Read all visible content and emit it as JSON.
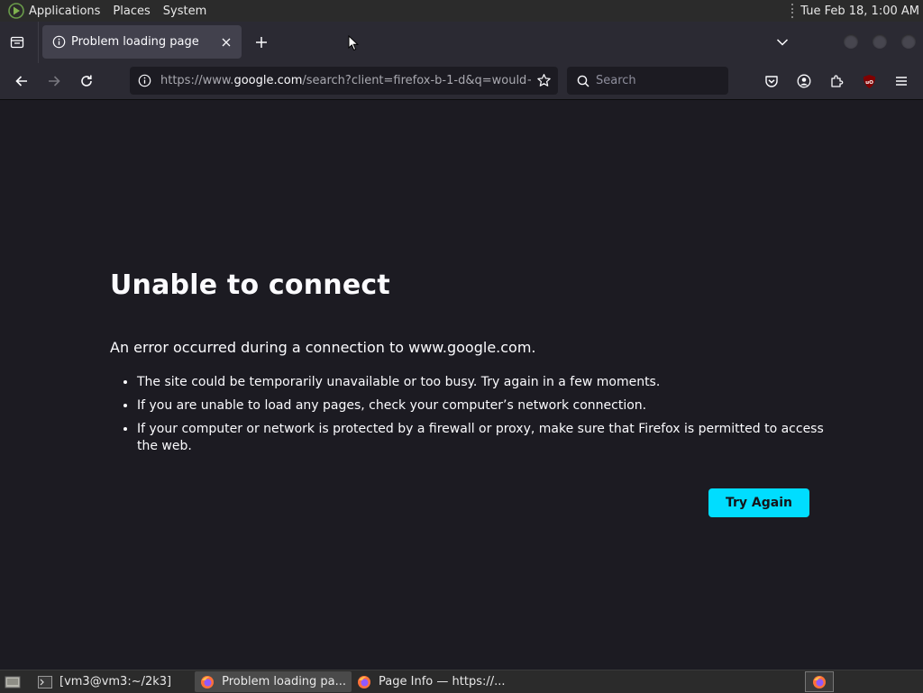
{
  "colors": {
    "page_background": "#1c1b22",
    "toolbar_background": "#2b2a33",
    "active_tab": "#42414d",
    "accent_button": "#00ddff",
    "system_panel": "#2b2b2b",
    "ublock_red": "#800000"
  },
  "system_bar": {
    "menus": [
      "Applications",
      "Places",
      "System"
    ],
    "clock": "Tue Feb 18,  1:00 AM",
    "logo_icon": "distro-logo-icon"
  },
  "browser": {
    "tab": {
      "title": "Problem loading page",
      "icon": "info-icon",
      "close_icon": "close-icon"
    },
    "url": {
      "prefix": "https://www.",
      "host": "google.com",
      "rest": "/search?client=firefox-b-1-d&q=would+"
    },
    "search": {
      "placeholder": "Search"
    },
    "icons": {
      "back": "back-arrow-icon",
      "forward": "forward-arrow-icon",
      "reload": "reload-icon",
      "bookmark": "star-icon",
      "pocket": "pocket-icon",
      "account": "account-icon",
      "extensions": "extensions-icon",
      "ublock": "ublock-origin-icon",
      "menu": "hamburger-menu-icon"
    }
  },
  "error_page": {
    "title": "Unable to connect",
    "intro": "An error occurred during a connection to www.google.com.",
    "items": [
      "The site could be temporarily unavailable or too busy. Try again in a few moments.",
      "If you are unable to load any pages, check your computer’s network connection.",
      "If your computer or network is protected by a firewall or proxy, make sure that Firefox is permitted to access the web."
    ],
    "button": "Try Again",
    "ublock_badge": "uO"
  },
  "taskbar": {
    "tasks": [
      {
        "label": "[vm3@vm3:~/2k3]",
        "icon": "terminal-icon"
      },
      {
        "label": "Problem loading pa...",
        "icon": "firefox-icon"
      },
      {
        "label": "Page Info — https://...",
        "icon": "firefox-icon"
      }
    ]
  }
}
